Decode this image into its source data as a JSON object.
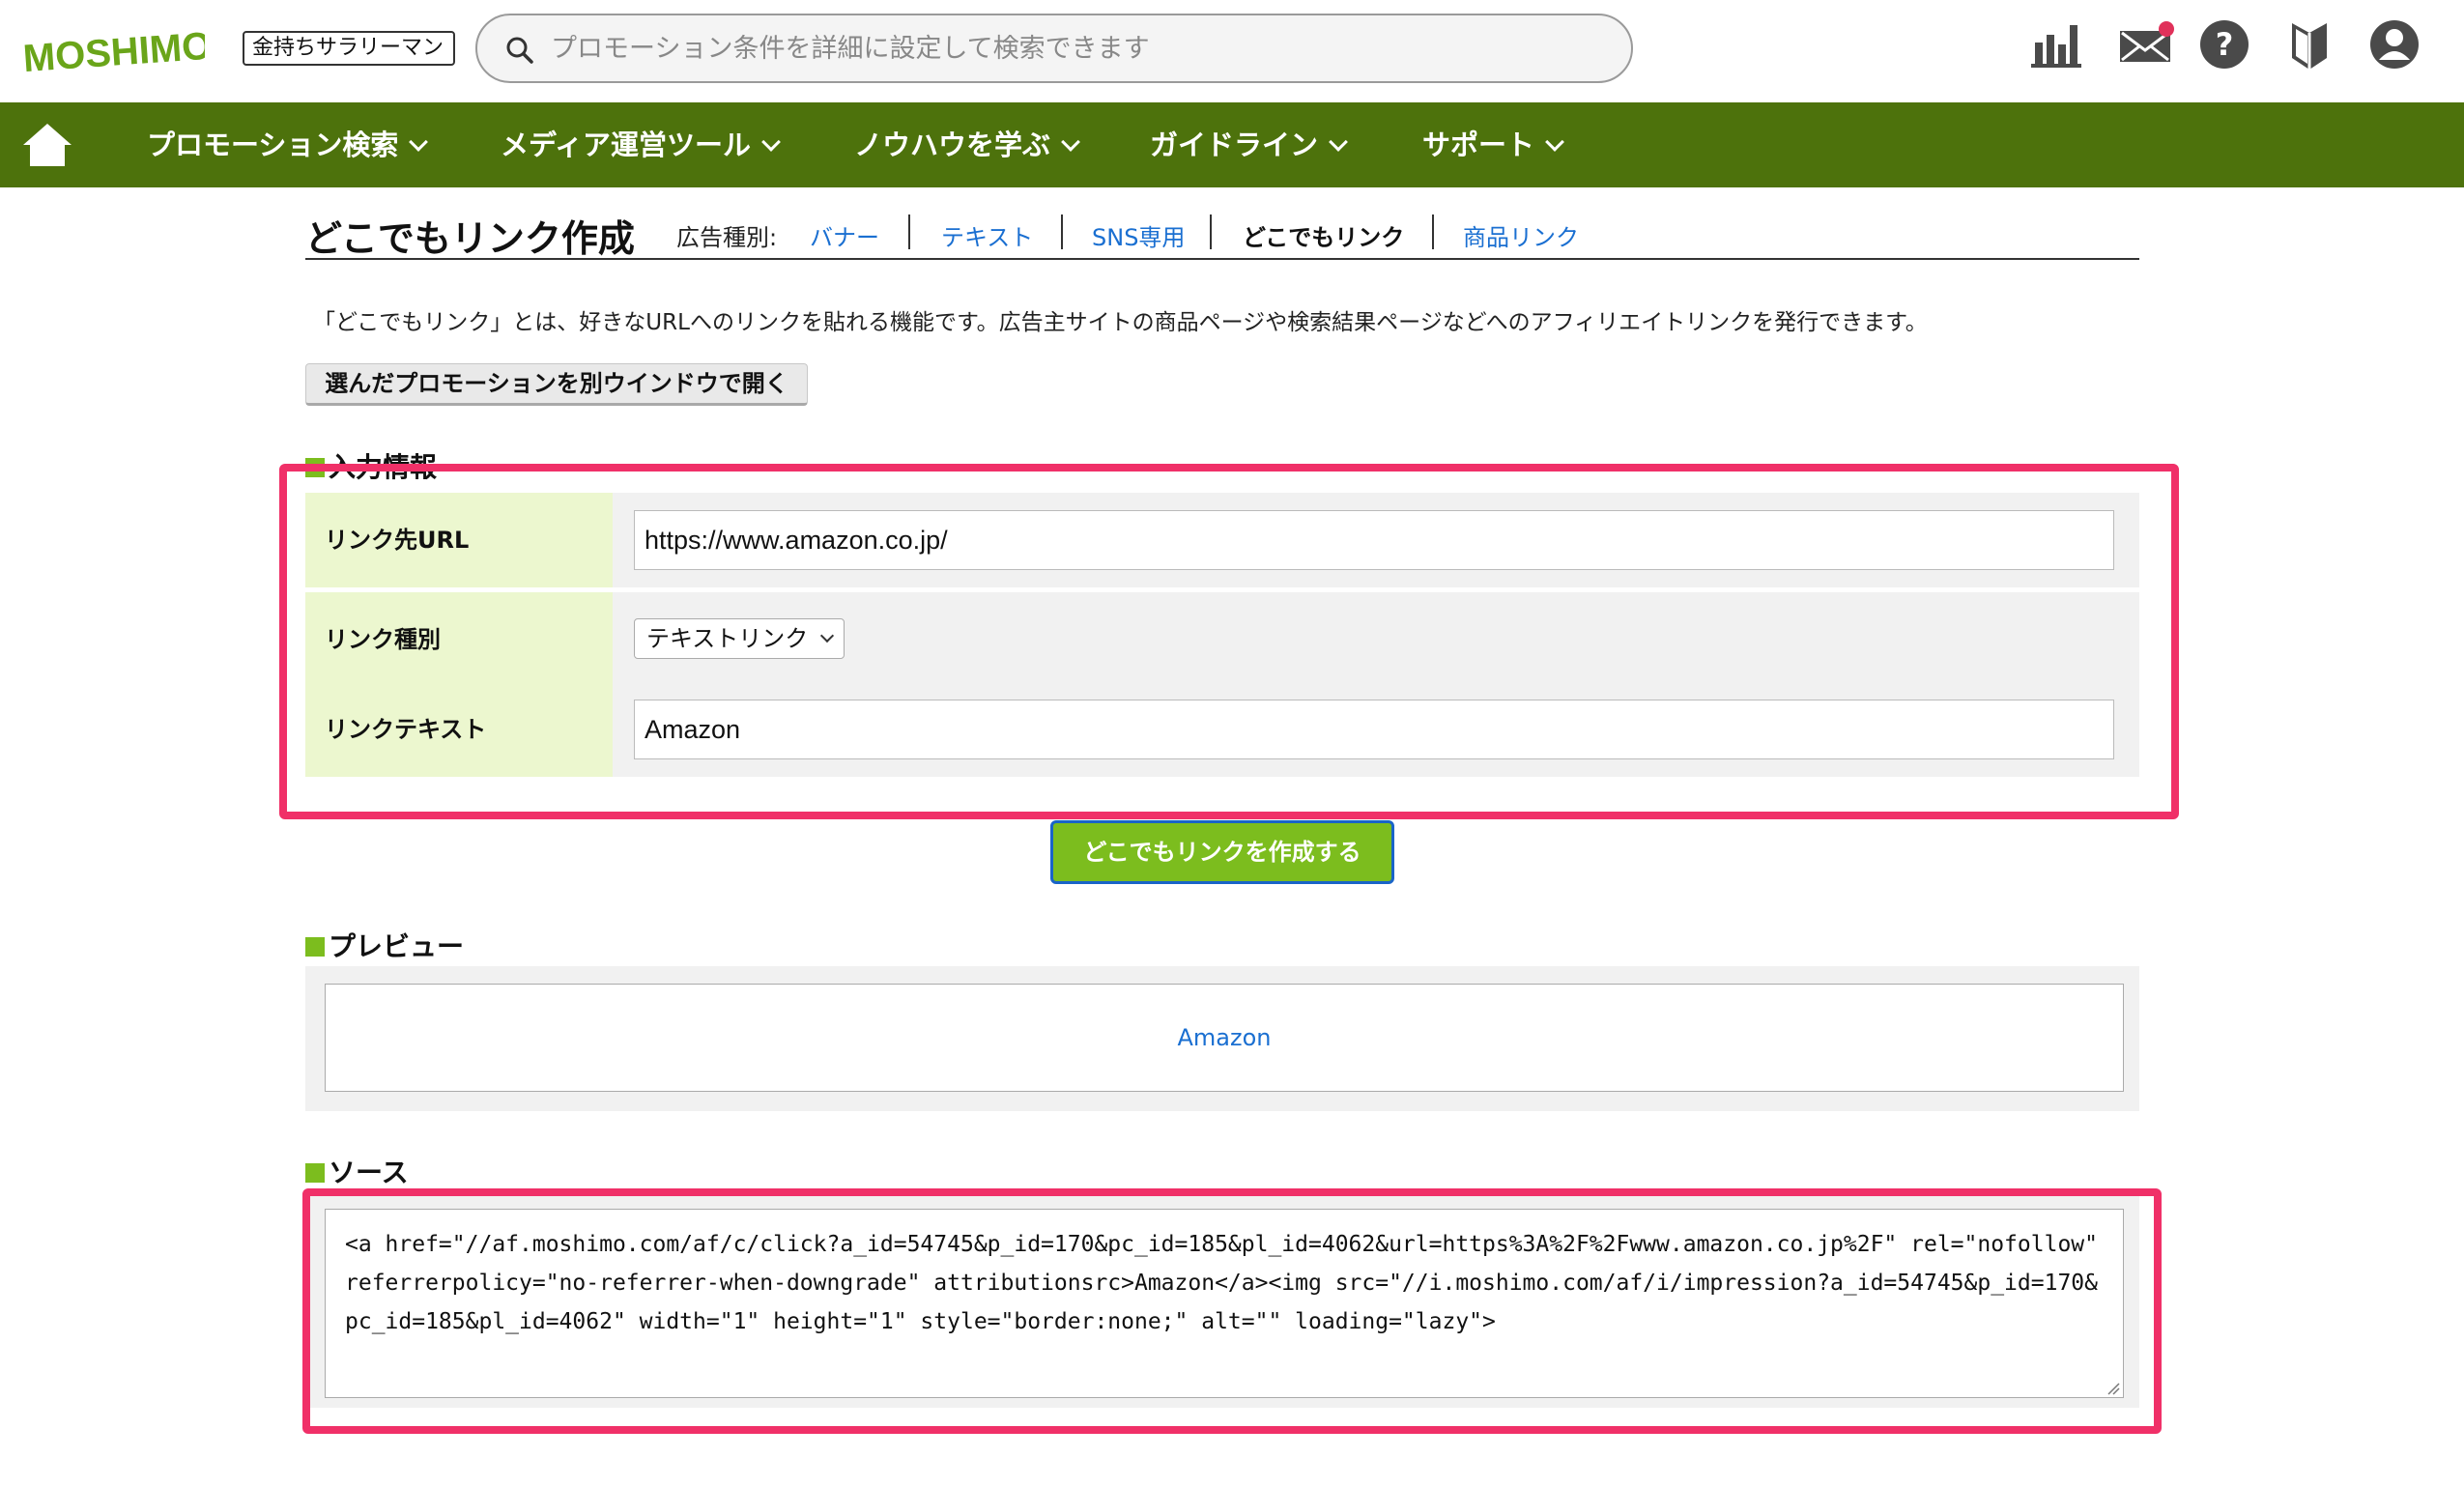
{
  "header": {
    "logo_text": "MOSHIMO",
    "user_select": "金持ちサラリーマン",
    "search_placeholder": "プロモーション条件を詳細に設定して検索できます"
  },
  "nav": {
    "items": [
      {
        "label": "プロモーション検索"
      },
      {
        "label": "メディア運営ツール"
      },
      {
        "label": "ノウハウを学ぶ"
      },
      {
        "label": "ガイドライン"
      },
      {
        "label": "サポート"
      }
    ]
  },
  "page": {
    "title": "どこでもリンク作成",
    "adtype_label": "広告種別:",
    "adtypes": [
      {
        "label": "バナー"
      },
      {
        "label": "テキスト"
      },
      {
        "label": "SNS専用"
      },
      {
        "label": "どこでもリンク"
      },
      {
        "label": "商品リンク"
      }
    ],
    "description": "「どこでもリンク」とは、好きなURLへのリンクを貼れる機能です。広告主サイトの商品ページや検索結果ページなどへのアフィリエイトリンクを発行できます。",
    "open_window_button": "選んだプロモーションを別ウインドウで開く"
  },
  "input_section": {
    "heading": "入力情報",
    "rows": [
      {
        "label": "リンク先URL",
        "value": "https://www.amazon.co.jp/"
      },
      {
        "label": "リンク種別",
        "value": "テキストリンク"
      },
      {
        "label": "リンクテキスト",
        "value": "Amazon"
      }
    ],
    "create_button": "どこでもリンクを作成する"
  },
  "preview_section": {
    "heading": "プレビュー",
    "link_text": "Amazon"
  },
  "source_section": {
    "heading": "ソース",
    "code": "<a href=\"//af.moshimo.com/af/c/click?a_id=54745&p_id=170&pc_id=185&pl_id=4062&url=https%3A%2F%2Fwww.amazon.co.jp%2F\" rel=\"nofollow\" referrerpolicy=\"no-referrer-when-downgrade\" attributionsrc>Amazon</a><img src=\"//i.moshimo.com/af/i/impression?a_id=54745&p_id=170&pc_id=185&pl_id=4062\" width=\"1\" height=\"1\" style=\"border:none;\" alt=\"\" loading=\"lazy\">"
  },
  "colors": {
    "nav_green": "#4d720c",
    "accent_green": "#7cbd1e",
    "label_bg": "#ecf7cf",
    "highlight_pink": "#f03068",
    "link_blue": "#1a6fd1"
  }
}
